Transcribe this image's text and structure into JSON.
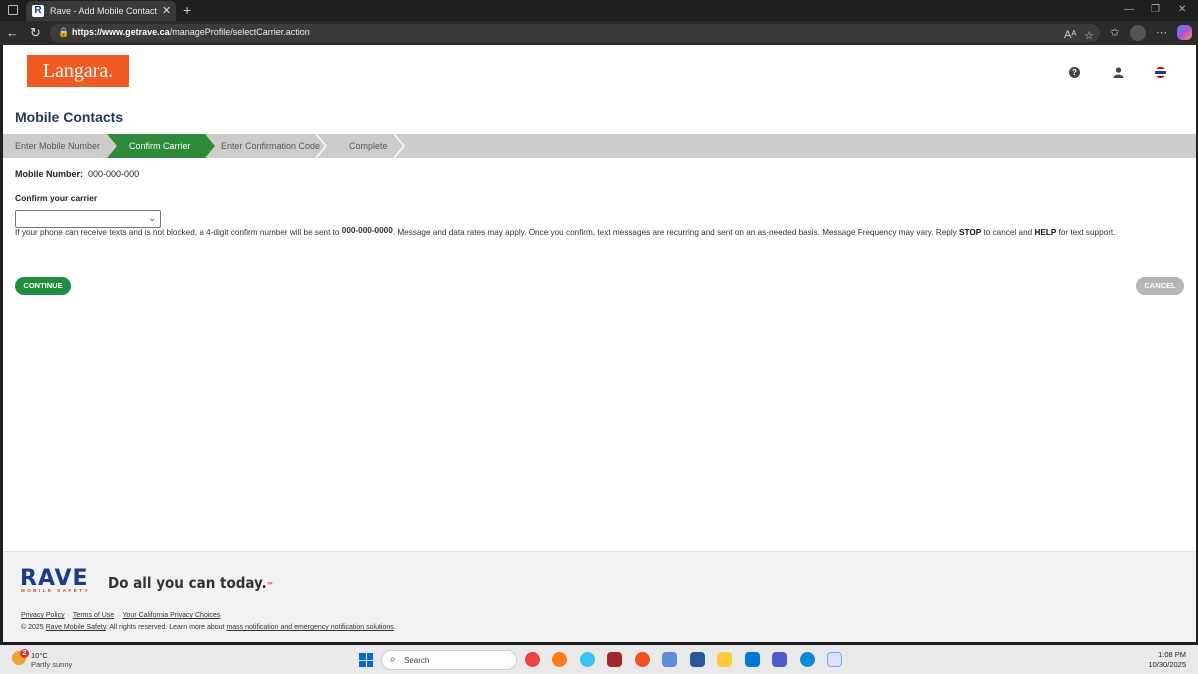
{
  "browser": {
    "tab_title": "Rave - Add Mobile Contact - Add",
    "tab_favicon": "R",
    "url_host": "https://www.getrave.ca",
    "url_path": "/manageProfile/selectCarrier.action"
  },
  "header": {
    "logo_text": "Langara.",
    "help_glyph": "?"
  },
  "page": {
    "title": "Mobile Contacts",
    "steps": [
      {
        "label": "Enter Mobile Number",
        "active": false
      },
      {
        "label": "Confirm Carrier",
        "active": true
      },
      {
        "label": "Enter Confirmation Code",
        "active": false
      },
      {
        "label": "Complete",
        "active": false
      }
    ],
    "mobile_label": "Mobile Number:",
    "mobile_value": "000-000-000",
    "carrier_label": "Confirm your carrier",
    "carrier_selected": "",
    "info_part1": "If your phone can receive texts and is not blocked, a 4-digit confirm number will be sent to ",
    "info_number": "000-000-0000",
    "info_part2": ". Message and data rates may apply. Once you confirm, text messages are recurring and sent on an as-needed basis. Message Frequency may vary. Reply ",
    "info_stop": "STOP",
    "info_part3": " to cancel and ",
    "info_help": "HELP",
    "info_part4": " for text support.",
    "continue_label": "CONTINUE",
    "cancel_label": "CANCEL"
  },
  "footer": {
    "rave_logo": "RAVE",
    "rave_sub": "MOBILE SAFETY",
    "tagline": "Do all you can today.",
    "tagline_tm": "™",
    "privacy": "Privacy Policy",
    "terms": "Terms of Use",
    "ca_privacy": "Your California Privacy Choices",
    "copy_prefix": "© 2025 ",
    "copy_link": "Rave Mobile Safety",
    "copy_mid": ". All rights reserved. Learn more about ",
    "copy_link2": "mass notification and emergency notification solutions",
    "copy_end": "."
  },
  "taskbar": {
    "weather_badge": "2",
    "temp": "10°C",
    "weather_desc": "Partly sunny",
    "search_placeholder": "Search",
    "time": "1:08 PM",
    "date": "10/30/2025"
  },
  "colors": {
    "brand_orange": "#f15a22",
    "step_active": "#2e8b3a",
    "continue_green": "#1e8e3e",
    "title_navy": "#24365f"
  }
}
